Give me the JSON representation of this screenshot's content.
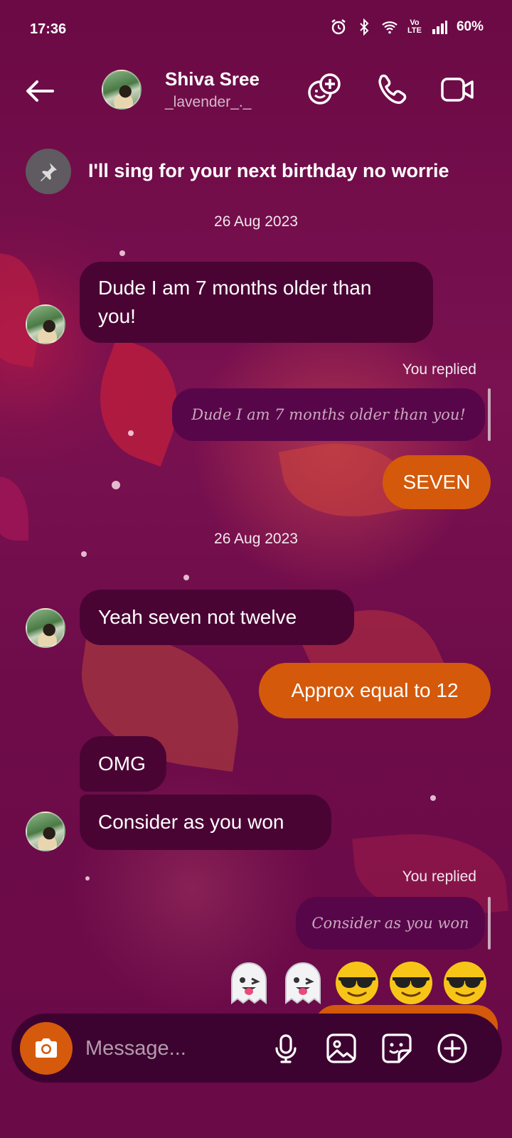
{
  "status_bar": {
    "time": "17:36",
    "network_label": "Vo LTE",
    "battery": "60%"
  },
  "header": {
    "name": "Shiva Sree",
    "username": "_lavender_._"
  },
  "pinned_message": {
    "text": "I'll sing for your next birthday no worrie"
  },
  "messages": [
    {
      "type": "date",
      "text": "26 Aug 2023"
    },
    {
      "type": "incoming",
      "text": "Dude I am 7 months older than you!"
    },
    {
      "type": "reply_label",
      "text": "You replied"
    },
    {
      "type": "reply_quote",
      "text": "Dude I am 7 months older than you!"
    },
    {
      "type": "outgoing",
      "text": "SEVEN"
    },
    {
      "type": "date",
      "text": "26 Aug 2023"
    },
    {
      "type": "incoming",
      "text": "Yeah seven not twelve"
    },
    {
      "type": "outgoing",
      "text": "Approx equal to 12"
    },
    {
      "type": "incoming",
      "text": "OMG"
    },
    {
      "type": "incoming",
      "text": "Consider as you won"
    },
    {
      "type": "reply_label",
      "text": "You replied"
    },
    {
      "type": "reply_quote",
      "text": "Consider as you won"
    },
    {
      "type": "emoji",
      "emojis": [
        "ghost-tongue",
        "ghost-tongue",
        "sunglasses-face",
        "sunglasses-face",
        "sunglasses-face"
      ]
    }
  ],
  "composer": {
    "placeholder": "Message..."
  },
  "colors": {
    "background": "#6b0a45",
    "incoming_bubble": "#4a0434",
    "outgoing_bubble": "#d4590a",
    "camera_button": "#d65a0c"
  }
}
